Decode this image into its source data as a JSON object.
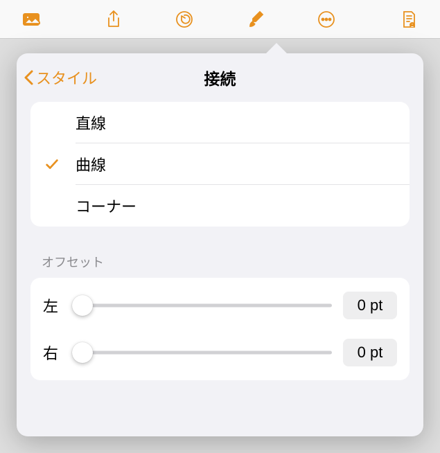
{
  "toolbar": {
    "icons": {
      "media": "media-icon",
      "share": "share-icon",
      "undo": "undo-icon",
      "format": "format-brush-icon",
      "more": "more-icon",
      "document": "document-icon"
    }
  },
  "popover": {
    "back_label": "スタイル",
    "title": "接続",
    "options": [
      {
        "label": "直線",
        "selected": false
      },
      {
        "label": "曲線",
        "selected": true
      },
      {
        "label": "コーナー",
        "selected": false
      }
    ],
    "offset": {
      "section_label": "オフセット",
      "left_label": "左",
      "left_value": "0 pt",
      "right_label": "右",
      "right_value": "0 pt"
    }
  }
}
